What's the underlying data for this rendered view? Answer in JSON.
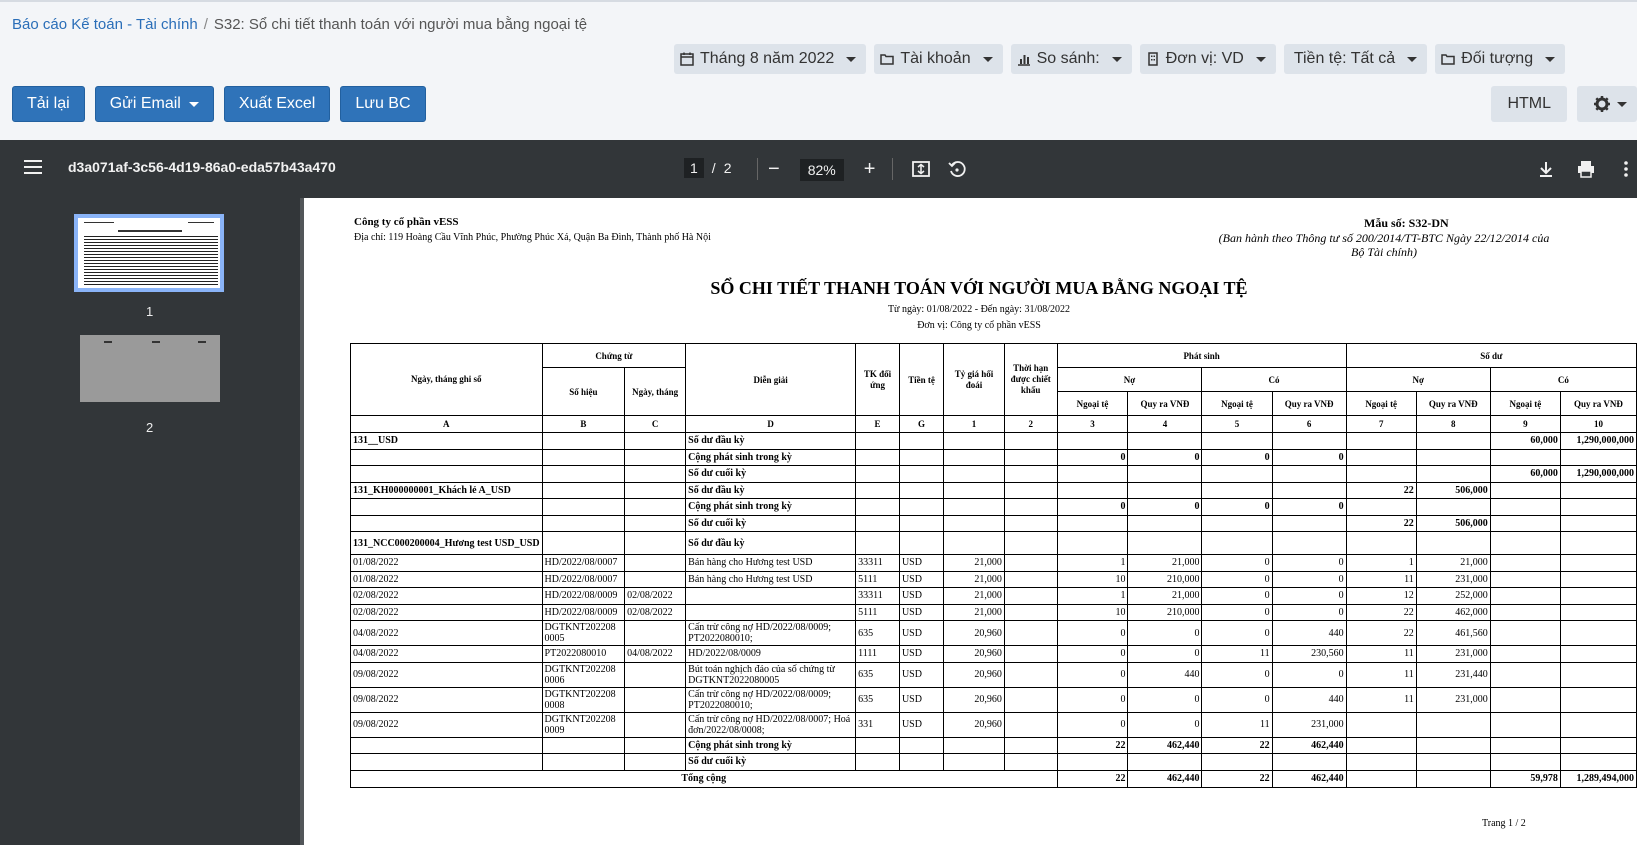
{
  "breadcrumb": {
    "parent": "Báo cáo Kế toán - Tài chính",
    "current": "S32: Sổ chi tiết thanh toán với người mua bằng ngoại tệ"
  },
  "filters": [
    {
      "icon": "calendar-icon",
      "label": "Tháng 8 năm 2022"
    },
    {
      "icon": "folder-icon",
      "label": "Tài khoản"
    },
    {
      "icon": "bar-chart-icon",
      "label": "So sánh:"
    },
    {
      "icon": "building-icon",
      "label": "Đơn vị: VD"
    },
    {
      "icon": "",
      "label": "Tiền tệ: Tất cả"
    },
    {
      "icon": "folder-icon",
      "label": "Đối tượng"
    }
  ],
  "actions": {
    "reload": "Tải lại",
    "email": "Gửi Email",
    "excel": "Xuất Excel",
    "save": "Lưu BC",
    "html": "HTML"
  },
  "viewer": {
    "file_name": "d3a071af-3c56-4d19-86a0-eda57b43a470",
    "page": "1",
    "total_pages": "2",
    "zoom": "82%",
    "thumb_labels": [
      "1",
      "2"
    ]
  },
  "report": {
    "company": "Công ty cổ phần vESS",
    "address": "Địa chỉ: 119 Hoàng Cầu Vĩnh Phúc, Phường Phúc Xá, Quận Ba Đình, Thành phố Hà Nội",
    "form_code": "Mẫu số: S32-DN",
    "form_note": "(Ban hành theo Thông tư số 200/2014/TT-BTC Ngày 22/12/2014 của Bộ Tài chính)",
    "title": "SỔ CHI TIẾT THANH TOÁN VỚI NGƯỜI MUA BẰNG NGOẠI TỆ",
    "date_range": "Từ ngày: 01/08/2022 - Đến ngày: 31/08/2022",
    "unit": "Đơn vị: Công ty cổ phần vESS",
    "headers": {
      "date": "Ngày, tháng ghi sổ",
      "voucher": "Chứng từ",
      "voucher_no": "Số hiệu",
      "voucher_date": "Ngày, tháng",
      "desc": "Diễn giải",
      "account": "TK đối ứng",
      "currency": "Tiền tệ",
      "rate": "Tỷ giá hối đoái",
      "discount": "Thời hạn được chiết khấu",
      "arising": "Phát sinh",
      "balance": "Số dư",
      "debit": "Nợ",
      "credit": "Có",
      "fc": "Ngoại tệ",
      "vnd": "Quy ra VNĐ"
    },
    "col_codes": [
      "A",
      "B",
      "C",
      "D",
      "E",
      "G",
      "1",
      "2",
      "3",
      "4",
      "5",
      "6",
      "7",
      "8",
      "9",
      "10"
    ],
    "rows": [
      {
        "bold": true,
        "c": [
          "131__USD",
          "",
          "",
          "Số dư đầu kỳ",
          "",
          "",
          "",
          "",
          "",
          "",
          "",
          "",
          "",
          "",
          "60,000",
          "1,290,000,000"
        ]
      },
      {
        "bold": true,
        "c": [
          "",
          "",
          "",
          "Cộng phát sinh trong kỳ",
          "",
          "",
          "",
          "",
          "0",
          "0",
          "0",
          "0",
          "",
          "",
          "",
          ""
        ]
      },
      {
        "bold": true,
        "c": [
          "",
          "",
          "",
          "Số dư cuối kỳ",
          "",
          "",
          "",
          "",
          "",
          "",
          "",
          "",
          "",
          "",
          "60,000",
          "1,290,000,000"
        ]
      },
      {
        "bold": true,
        "c": [
          "131_KH000000001_Khách lẻ A_USD",
          "",
          "",
          "Số dư đầu kỳ",
          "",
          "",
          "",
          "",
          "",
          "",
          "",
          "",
          "22",
          "506,000",
          "",
          ""
        ]
      },
      {
        "bold": true,
        "c": [
          "",
          "",
          "",
          "Cộng phát sinh trong kỳ",
          "",
          "",
          "",
          "",
          "0",
          "0",
          "0",
          "0",
          "",
          "",
          "",
          ""
        ]
      },
      {
        "bold": true,
        "c": [
          "",
          "",
          "",
          "Số dư cuối kỳ",
          "",
          "",
          "",
          "",
          "",
          "",
          "",
          "",
          "22",
          "506,000",
          "",
          ""
        ]
      },
      {
        "bold": true,
        "tall": true,
        "c": [
          "131_NCC000200004_Hương test USD_USD",
          "",
          "",
          "Số dư đầu kỳ",
          "",
          "",
          "",
          "",
          "",
          "",
          "",
          "",
          "",
          "",
          "",
          ""
        ]
      },
      {
        "c": [
          "01/08/2022",
          "HD/2022/08/0007",
          "",
          "Bán hàng cho Hương test USD",
          "33311",
          "USD",
          "21,000",
          "",
          "1",
          "21,000",
          "0",
          "0",
          "1",
          "21,000",
          "",
          ""
        ]
      },
      {
        "c": [
          "01/08/2022",
          "HD/2022/08/0007",
          "",
          "Bán hàng cho Hương test USD",
          "5111",
          "USD",
          "21,000",
          "",
          "10",
          "210,000",
          "0",
          "0",
          "11",
          "231,000",
          "",
          ""
        ]
      },
      {
        "c": [
          "02/08/2022",
          "HD/2022/08/0009",
          "02/08/2022",
          "",
          "33311",
          "USD",
          "21,000",
          "",
          "1",
          "21,000",
          "0",
          "0",
          "12",
          "252,000",
          "",
          ""
        ]
      },
      {
        "c": [
          "02/08/2022",
          "HD/2022/08/0009",
          "02/08/2022",
          "",
          "5111",
          "USD",
          "21,000",
          "",
          "10",
          "210,000",
          "0",
          "0",
          "22",
          "462,000",
          "",
          ""
        ]
      },
      {
        "tall": true,
        "c": [
          "04/08/2022",
          "DGTKNT202208 0005",
          "",
          "Cấn trừ công nợ HD/2022/08/0009; PT2022080010;",
          "635",
          "USD",
          "20,960",
          "",
          "0",
          "0",
          "0",
          "440",
          "22",
          "461,560",
          "",
          ""
        ]
      },
      {
        "c": [
          "04/08/2022",
          "PT2022080010",
          "04/08/2022",
          "HD/2022/08/0009",
          "1111",
          "USD",
          "20,960",
          "",
          "0",
          "0",
          "11",
          "230,560",
          "11",
          "231,000",
          "",
          ""
        ]
      },
      {
        "tall": true,
        "c": [
          "09/08/2022",
          "DGTKNT202208 0006",
          "",
          "Bút toán nghịch đảo của số chứng từ DGTKNT2022080005",
          "635",
          "USD",
          "20,960",
          "",
          "0",
          "440",
          "0",
          "0",
          "11",
          "231,440",
          "",
          ""
        ]
      },
      {
        "tall": true,
        "c": [
          "09/08/2022",
          "DGTKNT202208 0008",
          "",
          "Cấn trừ công nợ HD/2022/08/0009; PT2022080010;",
          "635",
          "USD",
          "20,960",
          "",
          "0",
          "0",
          "0",
          "440",
          "11",
          "231,000",
          "",
          ""
        ]
      },
      {
        "tall": true,
        "c": [
          "09/08/2022",
          "DGTKNT202208 0009",
          "",
          "Cấn trừ công nợ HD/2022/08/0007; Hoá đơn/2022/08/0008;",
          "331",
          "USD",
          "20,960",
          "",
          "0",
          "0",
          "11",
          "231,000",
          "",
          "",
          "",
          ""
        ]
      },
      {
        "bold": true,
        "c": [
          "",
          "",
          "",
          "Cộng phát sinh trong kỳ",
          "",
          "",
          "",
          "",
          "22",
          "462,440",
          "22",
          "462,440",
          "",
          "",
          "",
          ""
        ]
      },
      {
        "bold": true,
        "c": [
          "",
          "",
          "",
          "Số dư cuối kỳ",
          "",
          "",
          "",
          "",
          "",
          "",
          "",
          "",
          "",
          "",
          "",
          ""
        ]
      }
    ],
    "total": {
      "label": "Tổng cộng",
      "values": [
        "22",
        "462,440",
        "22",
        "462,440",
        "",
        "",
        "59,978",
        "1,289,494,000"
      ]
    },
    "page_number": "Trang 1 /  2"
  }
}
